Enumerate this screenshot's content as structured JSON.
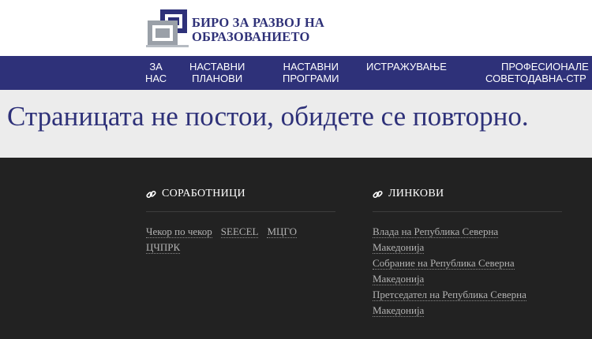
{
  "header": {
    "logo_line1": "БИРО ЗА РАЗВОЈ НА",
    "logo_line2": "ОБРАЗОВАНИЕТО"
  },
  "nav": {
    "items": [
      {
        "line1": "ЗА",
        "line2": "НАС"
      },
      {
        "line1": "НАСТАВНИ",
        "line2": "ПЛАНОВИ"
      },
      {
        "line1": "НАСТАВНИ",
        "line2": "ПРОГРАМИ"
      },
      {
        "line1": "ИСТРАЖУВАЊЕ",
        "line2": ""
      },
      {
        "line1": "ПРОФЕСИОНАЛЕ",
        "line2": "СОВЕТОДАВНА-СТР"
      }
    ]
  },
  "banner": {
    "message": "Страницата не постои, обидете се повторно."
  },
  "footer": {
    "partners": {
      "title": "СОРАБОТНИЦИ",
      "links": [
        "Чекор по чекор",
        "SEECEL",
        "МЦГО",
        "ЦЧПРК"
      ]
    },
    "links": {
      "title": "ЛИНКОВИ",
      "items": [
        {
          "line1": "Влада на Република Северна",
          "line2": "Македонија"
        },
        {
          "line1": "Собрание на Република Северна",
          "line2": "Македонија"
        },
        {
          "line1": "Претседател на Република Северна",
          "line2": "Македонија"
        }
      ]
    }
  },
  "colors": {
    "brand_navy": "#2e3179",
    "banner_bg": "#ececec",
    "footer_bg": "#222222"
  },
  "icons": {
    "logo": "bro-logo-mark",
    "section": "chain-link-icon"
  }
}
